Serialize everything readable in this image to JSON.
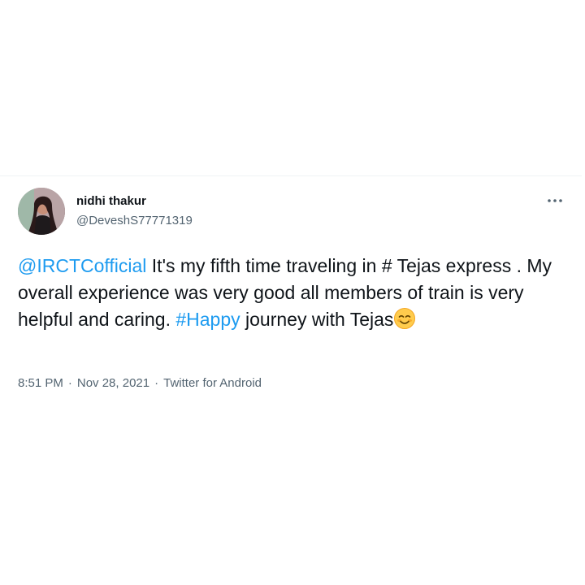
{
  "tweet": {
    "author": {
      "display_name": "nidhi thakur",
      "handle": "@DeveshS77771319"
    },
    "text": {
      "mention": "@IRCTCofficial",
      "part1": " It's my fifth time traveling in # Tejas express . My overall experience was very good all members of train is very helpful and caring. ",
      "hashtag": "#Happy",
      "part2": " journey with Tejas",
      "emoji": "smiling-face-with-smiling-eyes"
    },
    "meta": {
      "time": "8:51 PM",
      "date": "Nov 28, 2021",
      "source": "Twitter for Android",
      "separator": "·"
    },
    "icons": {
      "more": "more-options-icon"
    },
    "colors": {
      "link": "#1d9bf0",
      "text": "#0f1419",
      "secondary": "#536471"
    }
  }
}
